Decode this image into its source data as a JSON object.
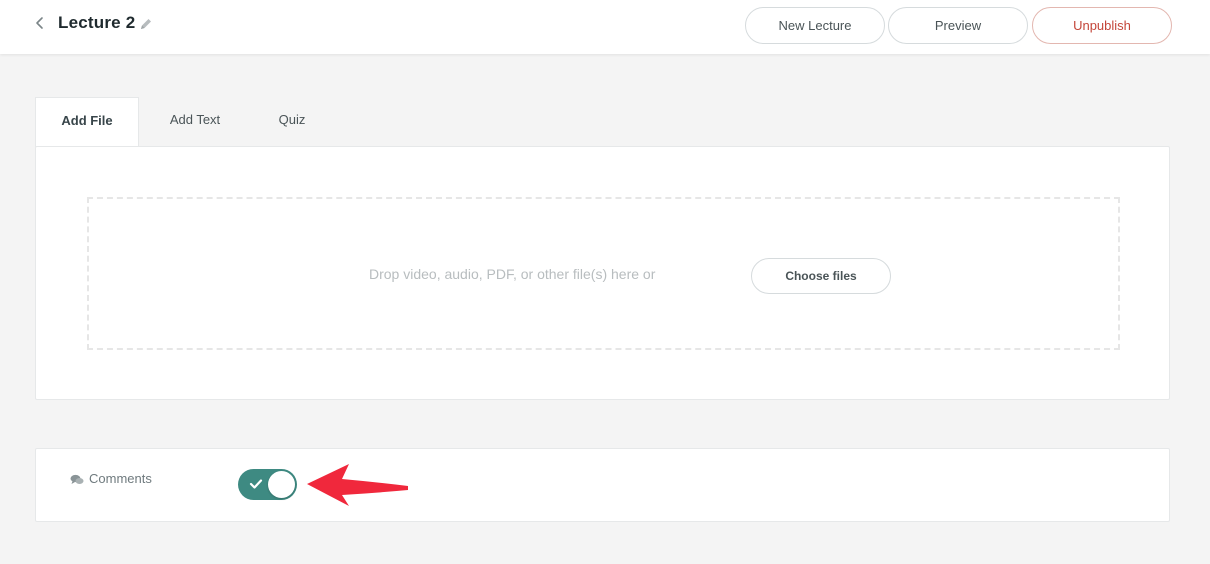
{
  "header": {
    "title": "Lecture 2",
    "buttons": {
      "new_lecture": "New Lecture",
      "preview": "Preview",
      "unpublish": "Unpublish"
    }
  },
  "tabs": [
    {
      "label": "Add File",
      "active": true
    },
    {
      "label": "Add Text",
      "active": false
    },
    {
      "label": "Quiz",
      "active": false
    }
  ],
  "dropzone": {
    "text": "Drop video, audio, PDF, or other file(s) here or",
    "button": "Choose files"
  },
  "comments": {
    "label": "Comments",
    "enabled": true
  },
  "colors": {
    "toggle_on": "#3e8a82",
    "unpublish": "#c4463a",
    "annotation_arrow": "#f0283c"
  },
  "icons": [
    "chevron-left-icon",
    "pencil-icon",
    "comment-icon",
    "check-icon",
    "arrow-annotation"
  ]
}
